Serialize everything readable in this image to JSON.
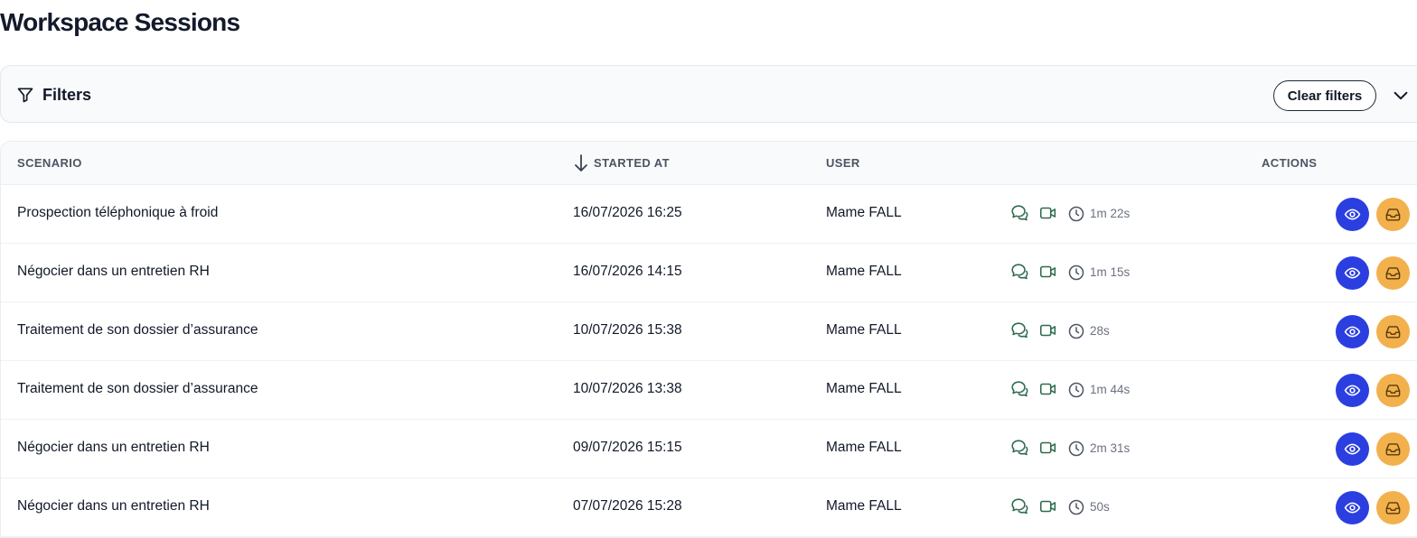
{
  "page": {
    "title": "Workspace Sessions"
  },
  "filters": {
    "label": "Filters",
    "clear_label": "Clear filters",
    "icon": "filter-icon",
    "toggle_icon": "chevron-down-icon"
  },
  "table": {
    "columns": {
      "scenario": "SCENARIO",
      "started_at": "STARTED AT",
      "user": "USER",
      "actions": "ACTIONS"
    },
    "sort": {
      "column": "started_at",
      "direction": "descending",
      "icon": "arrow-down-icon"
    },
    "rows": [
      {
        "scenario": "Prospection téléphonique à froid",
        "started_at": "16/07/2026 16:25",
        "user": "Mame FALL",
        "duration": "1m 22s"
      },
      {
        "scenario": "Négocier dans un entretien RH",
        "started_at": "16/07/2026 14:15",
        "user": "Mame FALL",
        "duration": "1m 15s"
      },
      {
        "scenario": "Traitement de son dossier d’assurance",
        "started_at": "10/07/2026 15:38",
        "user": "Mame FALL",
        "duration": "28s"
      },
      {
        "scenario": "Traitement de son dossier d’assurance",
        "started_at": "10/07/2026 13:38",
        "user": "Mame FALL",
        "duration": "1m 44s"
      },
      {
        "scenario": "Négocier dans un entretien RH",
        "started_at": "09/07/2026 15:15",
        "user": "Mame FALL",
        "duration": "2m 31s"
      },
      {
        "scenario": "Négocier dans un entretien RH",
        "started_at": "07/07/2026 15:28",
        "user": "Mame FALL",
        "duration": "50s"
      }
    ],
    "row_icons": [
      "chat-icon",
      "video-icon",
      "clock-icon"
    ],
    "action_icons": [
      "eye-icon",
      "inbox-icon"
    ]
  },
  "colors": {
    "title": "#131a2b",
    "icon_green": "#2f6b4f",
    "view_button": "#2b3fe0",
    "archive_button": "#f2b14c",
    "muted_text": "#6b7280"
  }
}
